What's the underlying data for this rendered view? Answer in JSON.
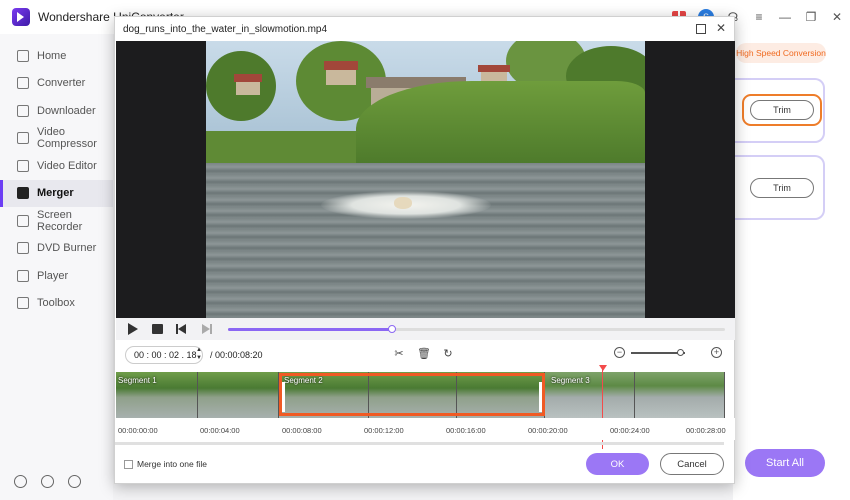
{
  "app": {
    "title": "Wondershare UniConverter",
    "avatar_initial": "S"
  },
  "sidebar": {
    "items": [
      {
        "label": "Home"
      },
      {
        "label": "Converter"
      },
      {
        "label": "Downloader"
      },
      {
        "label": "Video Compressor"
      },
      {
        "label": "Video Editor"
      },
      {
        "label": "Merger",
        "active": true
      },
      {
        "label": "Screen Recorder"
      },
      {
        "label": "DVD Burner"
      },
      {
        "label": "Player"
      },
      {
        "label": "Toolbox"
      }
    ]
  },
  "right_panel": {
    "high_speed": "High Speed Conversion",
    "trim_label": "Trim",
    "trim2_label": "Trim",
    "start_all": "Start All"
  },
  "dialog": {
    "title": "dog_runs_into_the_water_in_slowmotion.mp4",
    "progress": 0.33,
    "current_time": "00 : 00 : 02 . 18",
    "total_time": "/ 00:00:08:20",
    "zoom_level": 0.92,
    "segments": [
      {
        "label": "Segment 1"
      },
      {
        "label": "Segment 2"
      },
      {
        "label": "Segment 3"
      }
    ],
    "ruler_labels": [
      "00:00:00:00",
      "00:00:04:00",
      "00:00:08:00",
      "00:00:12:00",
      "00:00:16:00",
      "00:00:20:00",
      "00:00:24:00",
      "00:00:28:00"
    ],
    "merge_label": "Merge into one file",
    "ok_label": "OK",
    "cancel_label": "Cancel"
  },
  "colors": {
    "accent": "#8b67f3",
    "selection": "#f05a24",
    "highlight": "#ee7d2a"
  }
}
